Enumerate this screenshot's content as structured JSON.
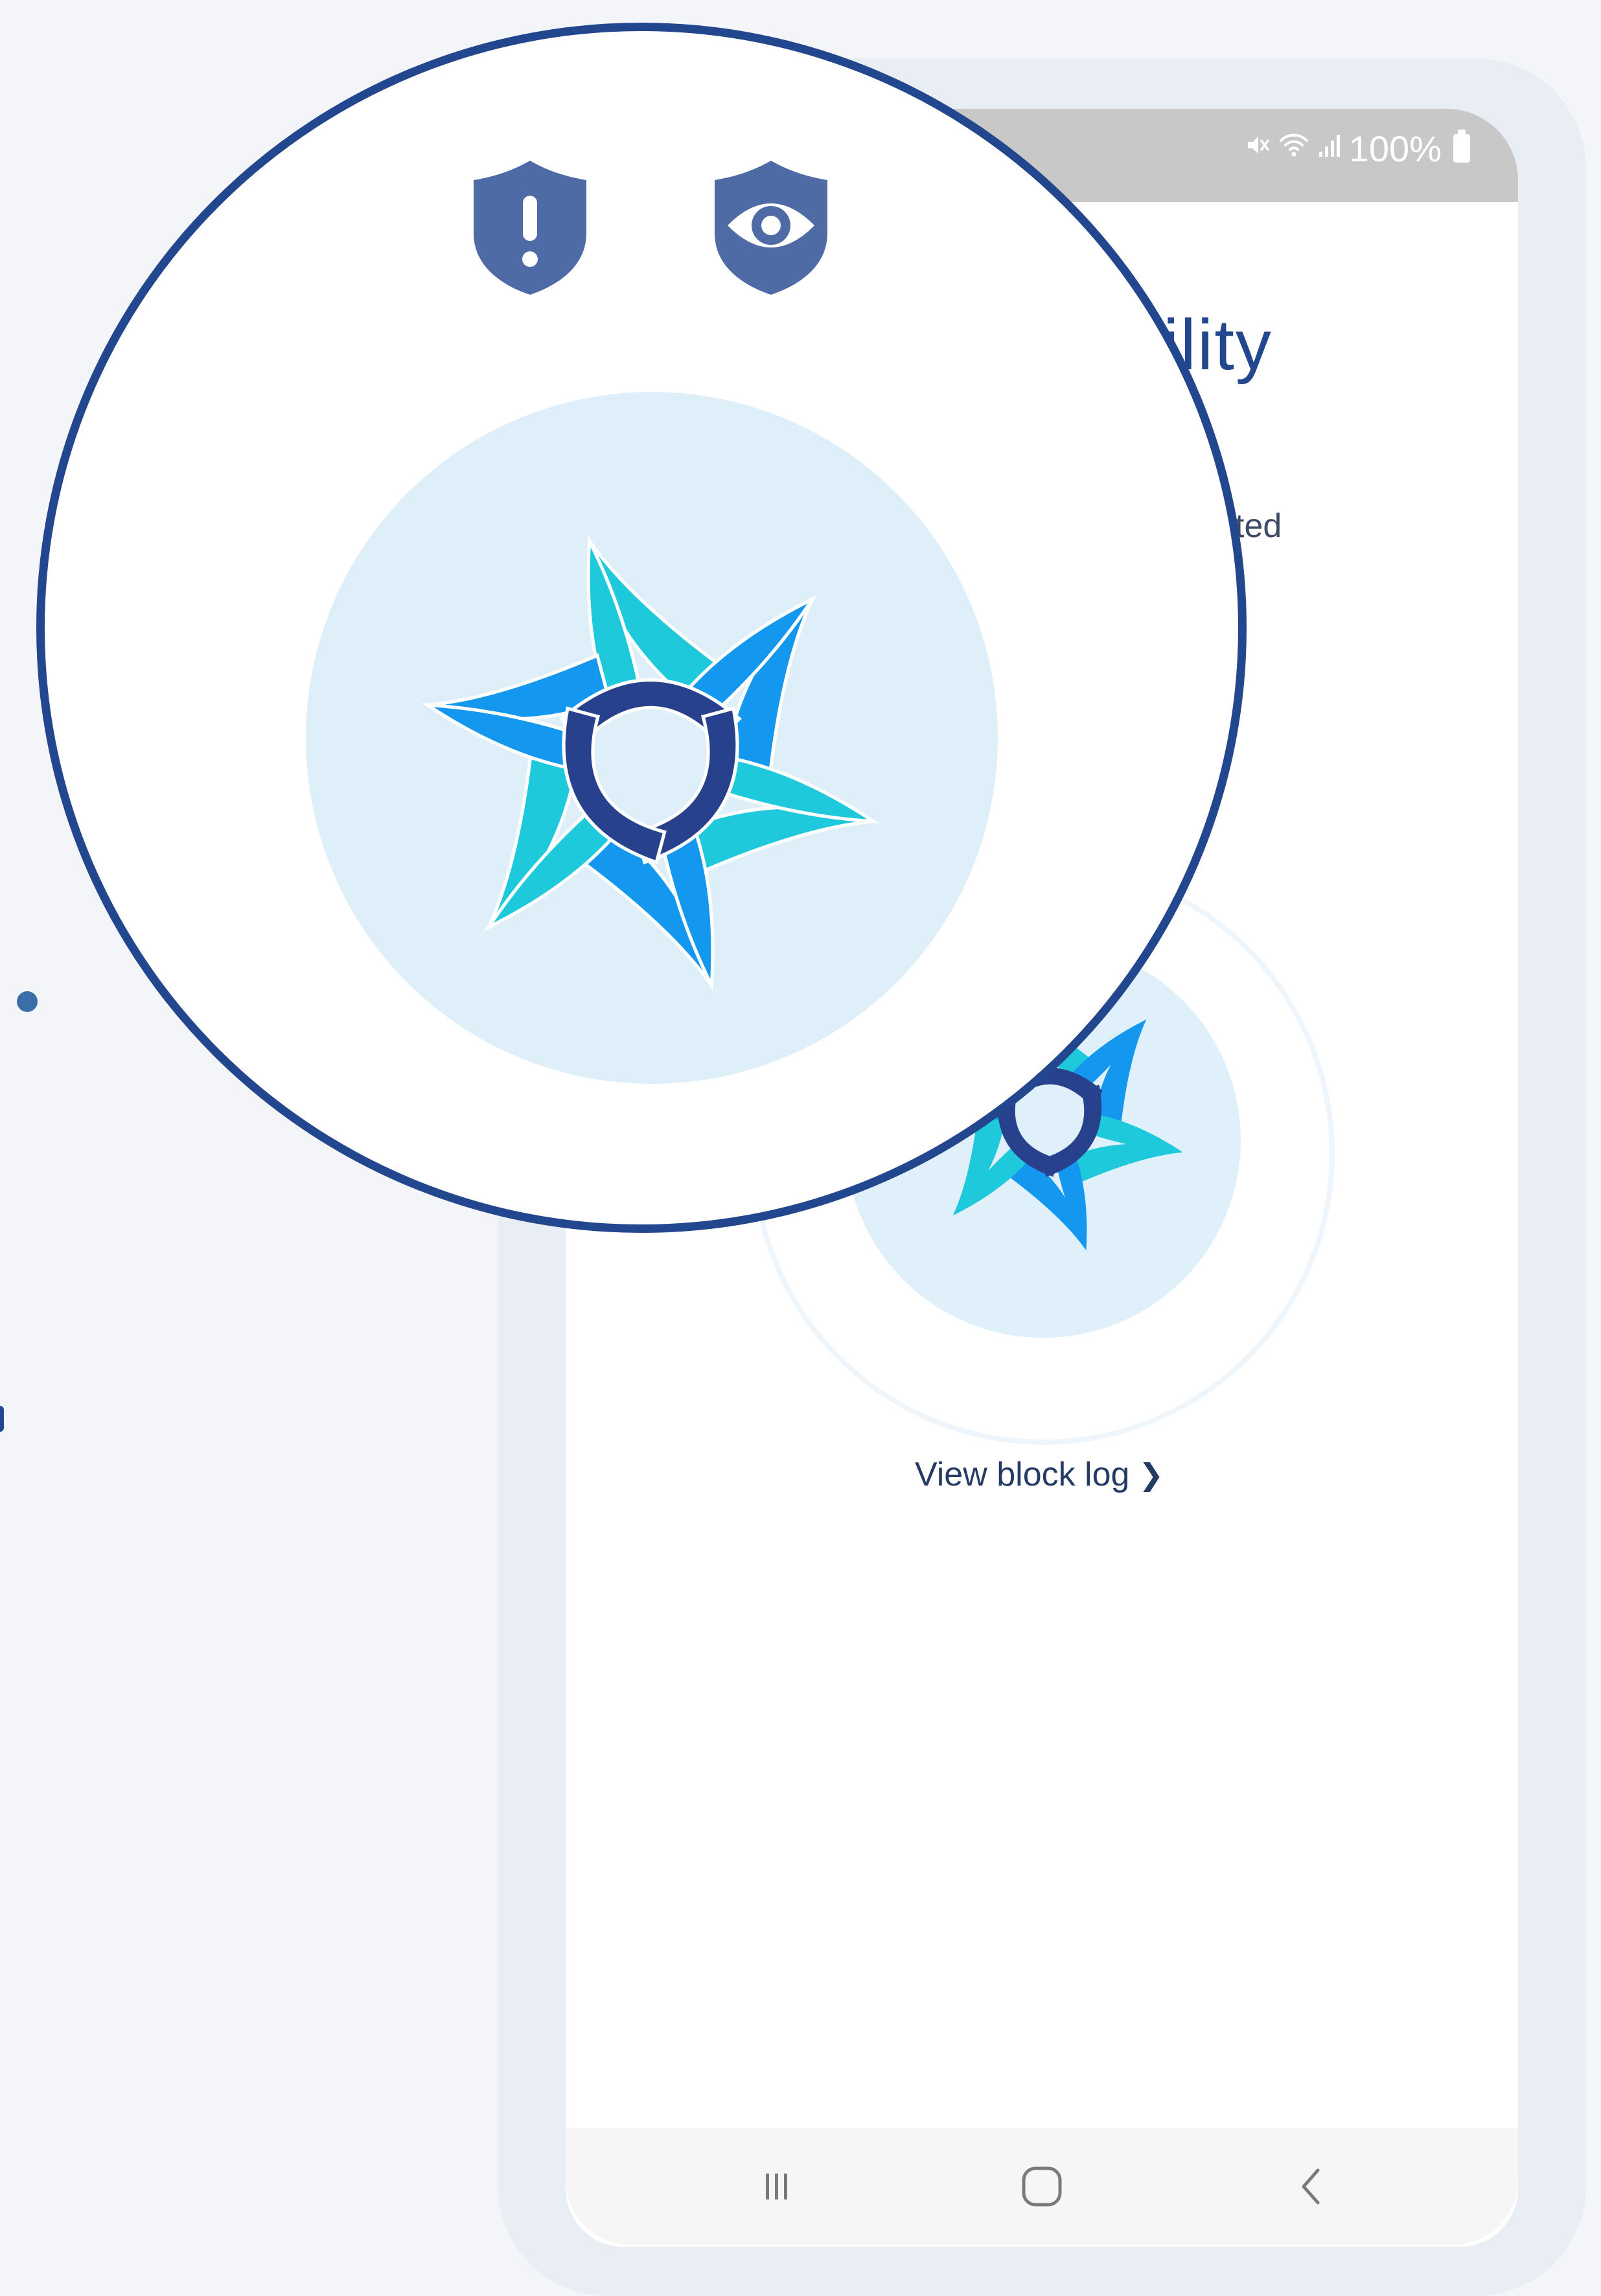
{
  "colors": {
    "background": "#f3f5f9",
    "phone_frame": "#e9eef5",
    "status_bar": "#c8c8c8",
    "accent_navy": "#23478f",
    "shield_blue": "#4e6ba6",
    "logo_cyan": "#1ec9dc",
    "logo_blue": "#1497ee",
    "logo_navy": "#28418d",
    "halo": "#dff0fa"
  },
  "status_bar": {
    "icons": [
      "mute-icon",
      "wifi-icon",
      "signal-icon",
      "battery-icon"
    ],
    "battery_text": "100%"
  },
  "header": {
    "settings_icon": "gear-icon",
    "title_fragment": "ility"
  },
  "status": {
    "fragment": "cted"
  },
  "block_log": {
    "label": "View block log",
    "chevron": "❯"
  },
  "magnifier": {
    "shields": [
      "shield-alert-icon",
      "shield-eye-icon"
    ],
    "logo": "star-knot-logo"
  },
  "nav_bar": {
    "items": [
      {
        "name": "recent-apps",
        "icon": "recent-apps-icon"
      },
      {
        "name": "home",
        "icon": "home-icon"
      },
      {
        "name": "back",
        "icon": "back-icon"
      }
    ]
  }
}
